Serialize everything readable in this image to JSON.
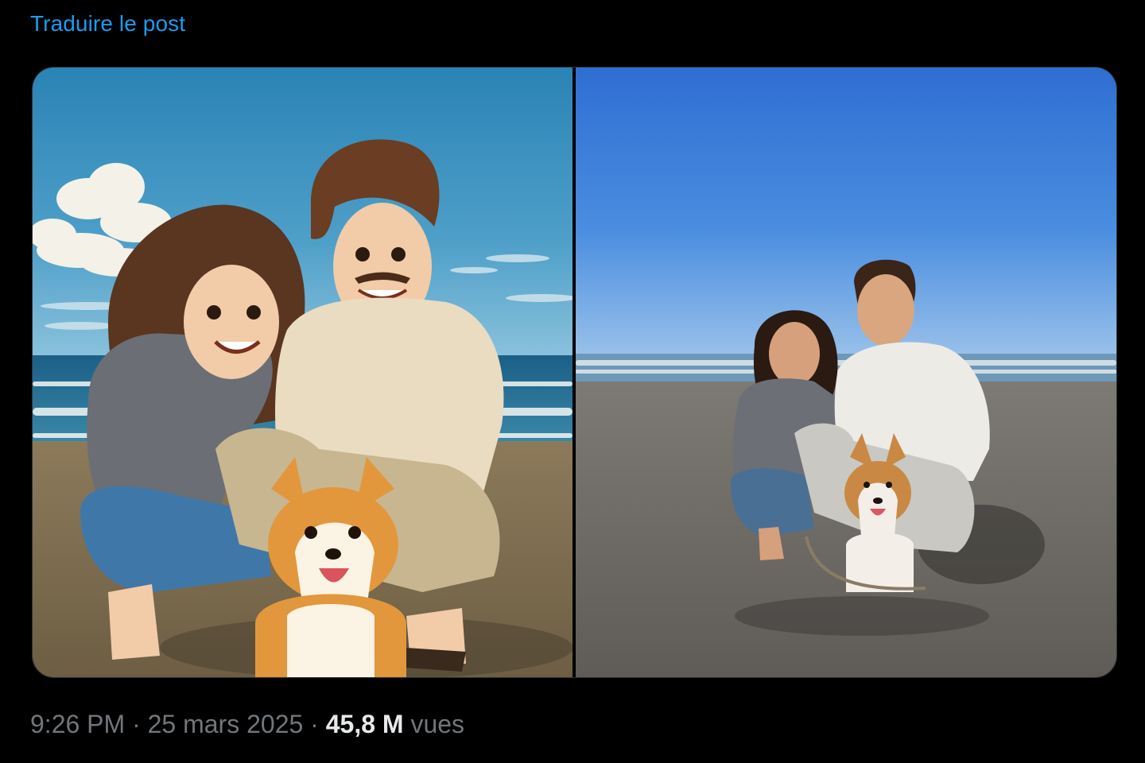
{
  "post": {
    "translate_label": "Traduire le post",
    "time": "9:26 PM",
    "separator": "·",
    "date": "25 mars 2025",
    "views_count": "45,8 M",
    "views_label": "vues"
  },
  "media": [
    {
      "kind": "illustration",
      "subject": "anime-style couple with corgi on beach"
    },
    {
      "kind": "photo",
      "subject": "couple with corgi on beach"
    }
  ],
  "colors": {
    "background": "#000000",
    "link": "#1d9bf0",
    "muted_text": "#71767b",
    "strong_text": "#e7e9ea",
    "media_border": "#2f3336"
  }
}
